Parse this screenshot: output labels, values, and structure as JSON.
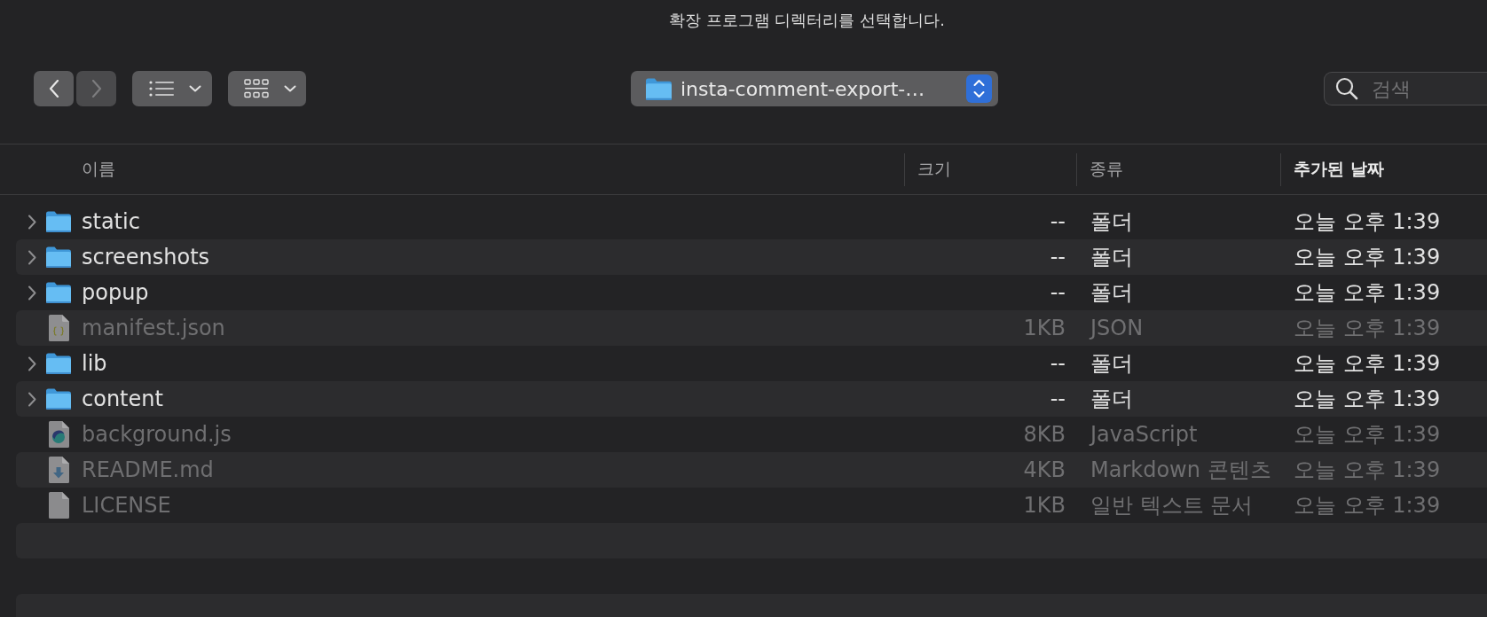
{
  "window": {
    "title": "확장 프로그램 디렉터리를 선택합니다."
  },
  "toolbar": {
    "nav_buttons": [
      {
        "kind": "back",
        "disabled": false
      },
      {
        "kind": "forward",
        "disabled": true
      }
    ],
    "path": {
      "label": "insta-comment-export-…"
    },
    "search": {
      "placeholder": "검색"
    }
  },
  "table": {
    "columns": [
      {
        "label": "이름",
        "sorted": false
      },
      {
        "label": "크기",
        "sorted": false
      },
      {
        "label": "종류",
        "sorted": false
      },
      {
        "label": "추가된 날짜",
        "sorted": true
      }
    ],
    "rows": [
      {
        "kind": "folder",
        "name": "static",
        "size": "--",
        "type": "폴더",
        "date": "오늘 오후 1:39",
        "disabled": false
      },
      {
        "kind": "folder",
        "name": "screenshots",
        "size": "--",
        "type": "폴더",
        "date": "오늘 오후 1:39",
        "disabled": false
      },
      {
        "kind": "folder",
        "name": "popup",
        "size": "--",
        "type": "폴더",
        "date": "오늘 오후 1:39",
        "disabled": false
      },
      {
        "kind": "json",
        "name": "manifest.json",
        "size": "1KB",
        "type": "JSON",
        "date": "오늘 오후 1:39",
        "disabled": true
      },
      {
        "kind": "folder",
        "name": "lib",
        "size": "--",
        "type": "폴더",
        "date": "오늘 오후 1:39",
        "disabled": false
      },
      {
        "kind": "folder",
        "name": "content",
        "size": "--",
        "type": "폴더",
        "date": "오늘 오후 1:39",
        "disabled": false
      },
      {
        "kind": "script",
        "name": "background.js",
        "size": "8KB",
        "type": "JavaScript",
        "date": "오늘 오후 1:39",
        "disabled": true
      },
      {
        "kind": "markdown",
        "name": "README.md",
        "size": "4KB",
        "type": "Markdown 콘텐츠",
        "date": "오늘 오후 1:39",
        "disabled": true
      },
      {
        "kind": "text",
        "name": "LICENSE",
        "size": "1KB",
        "type": "일반 텍스트 문서",
        "date": "오늘 오후 1:39",
        "disabled": true
      }
    ]
  }
}
